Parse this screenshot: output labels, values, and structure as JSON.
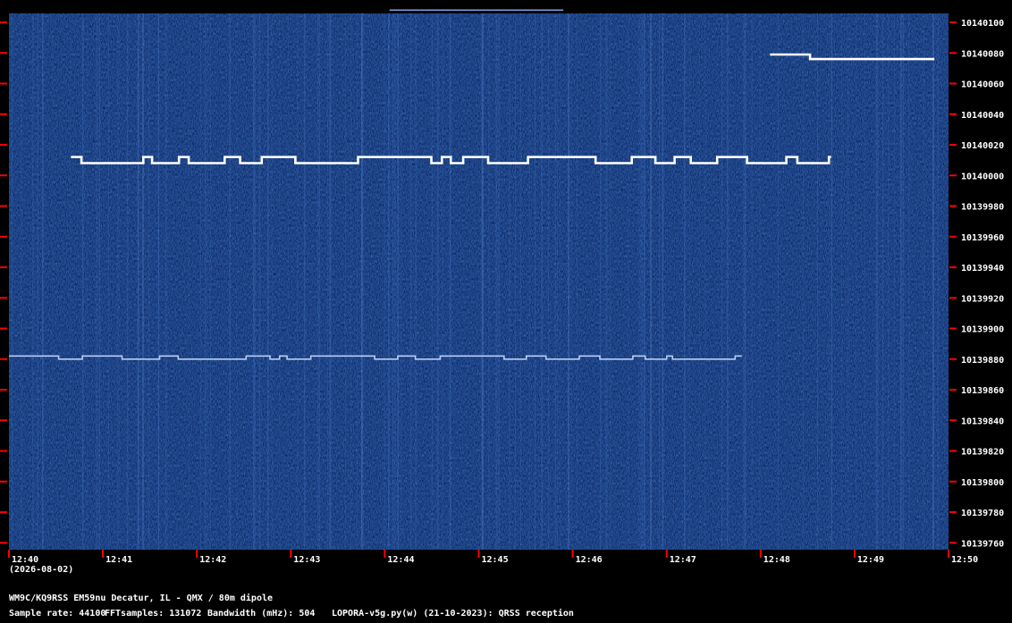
{
  "chart_data": {
    "type": "heatmap",
    "title": "WM9C/KQ9RSS EM59nu Decatur, IL - QMX / 80m dipole",
    "xlabel": "",
    "ylabel": "",
    "x_ticks": [
      "12:40",
      "12:41",
      "12:42",
      "12:43",
      "12:44",
      "12:45",
      "12:46",
      "12:47",
      "12:48",
      "12:49",
      "12:50"
    ],
    "x_date": "(2026-08-02)",
    "y_ticks": [
      "10140100",
      "10140080",
      "10140060",
      "10140040",
      "10140020",
      "10140000",
      "10139980",
      "10139960",
      "10139940",
      "10139920",
      "10139900",
      "10139880",
      "10139860",
      "10139840",
      "10139820",
      "10139800",
      "10139780",
      "10139760"
    ],
    "ylim": [
      10139752,
      10140108
    ],
    "xlim": [
      0,
      10
    ],
    "grid": false,
    "traces": [
      {
        "freq": 10140008,
        "freq_high": 10140012,
        "x_start": 0.66,
        "x_end": 8.75,
        "brightness": "bright"
      },
      {
        "freq": 10139880,
        "freq_high": 10139882,
        "x_start": 0.0,
        "x_end": 7.8,
        "brightness": "medium"
      },
      {
        "freq": 10140076,
        "freq_high": 10140079,
        "x_start": 8.1,
        "x_end": 9.85,
        "brightness": "bright"
      },
      {
        "freq": 10140108,
        "freq_high": 10140108,
        "x_start": 4.05,
        "x_end": 5.9,
        "brightness": "dim"
      }
    ]
  },
  "footer": {
    "station": "WM9C/KQ9RSS EM59nu Decatur, IL - QMX / 80m dipole",
    "sample_rate": "Sample rate: 44100",
    "fft_samples": "FFTsamples: 131072",
    "bandwidth": "Bandwidth (mHz): 504",
    "software": "LOPORA-v5g.py(w) (21-10-2023): QRSS reception"
  },
  "colors": {
    "background": "#0d2a6b",
    "noise_dark": "#0a2260",
    "noise_light": "#2c56a8",
    "trace": "#ffffff",
    "tick": "#ff0000",
    "text": "#ffffff"
  }
}
